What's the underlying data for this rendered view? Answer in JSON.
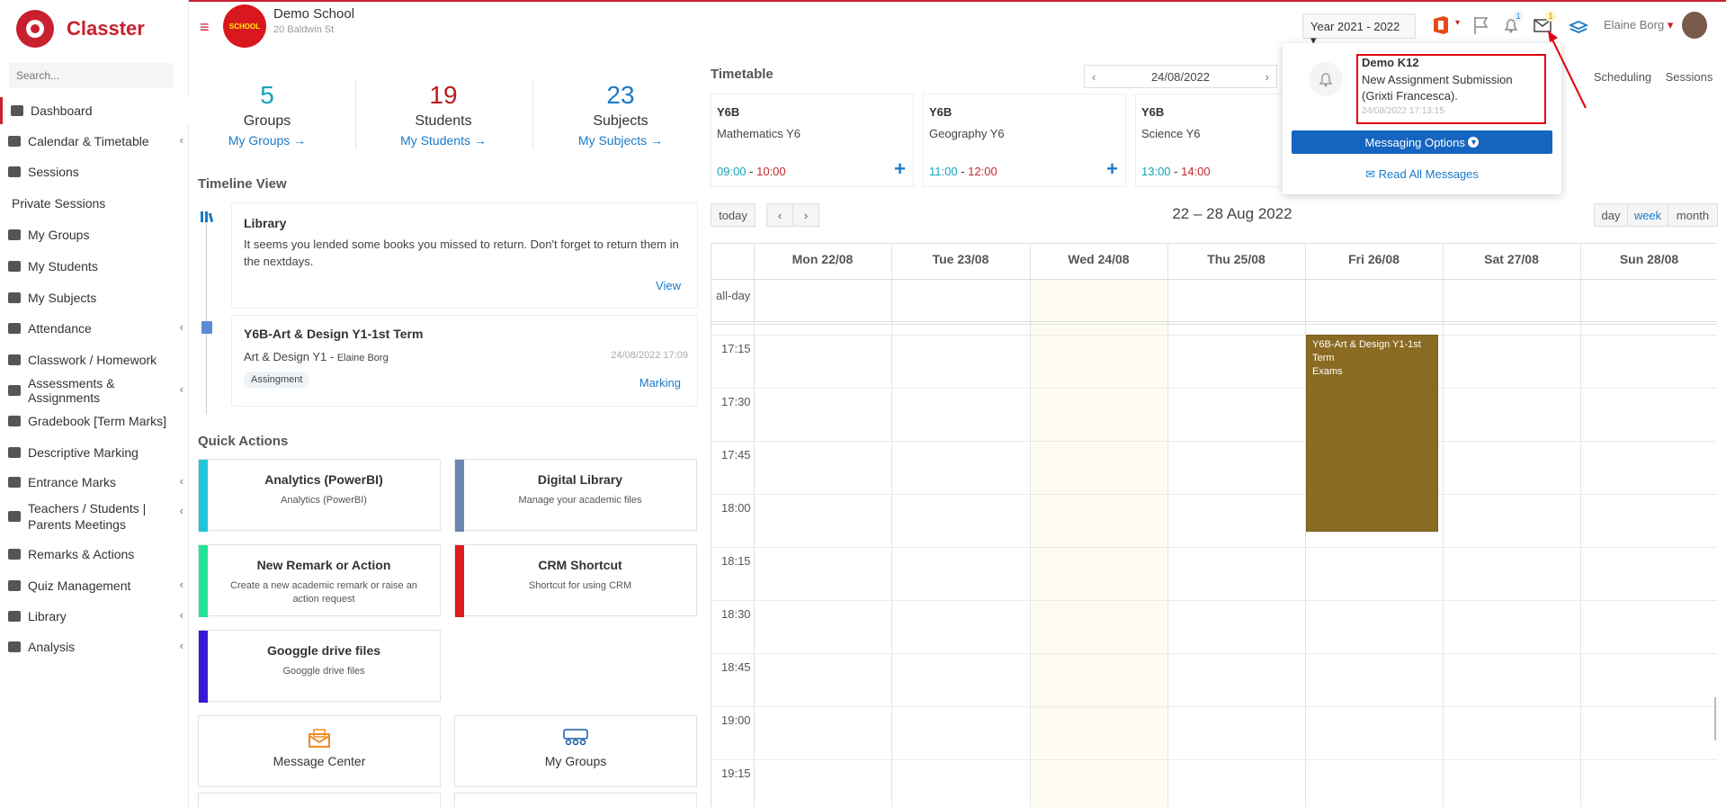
{
  "app": {
    "brand": "Classter",
    "search_placeholder": "Search...",
    "accent": "#c8202e"
  },
  "sidebar": {
    "items": [
      {
        "label": "Dashboard",
        "icon": "laptop-icon",
        "active": true
      },
      {
        "label": "Calendar & Timetable",
        "icon": "calendar-icon",
        "chevron": true
      },
      {
        "label": "Sessions",
        "icon": "sessions-icon"
      },
      {
        "label": "Private Sessions"
      },
      {
        "label": "My Groups",
        "icon": "groups-icon"
      },
      {
        "label": "My Students",
        "icon": "students-icon"
      },
      {
        "label": "My Subjects",
        "icon": "book-icon"
      },
      {
        "label": "Attendance",
        "icon": "attendance-icon",
        "chevron": true
      },
      {
        "label": "Classwork / Homework",
        "icon": "list-icon"
      },
      {
        "label": "Assessments & Assignments",
        "icon": "edit-icon",
        "chevron": true
      },
      {
        "label": "Gradebook [Term Marks]",
        "icon": "gradebook-icon"
      },
      {
        "label": "Descriptive Marking",
        "icon": "marking-icon"
      },
      {
        "label": "Entrance Marks",
        "icon": "clipboard-icon",
        "chevron": true
      },
      {
        "label": "Teachers / Students | Parents Meetings",
        "icon": "meeting-icon",
        "chevron": true
      },
      {
        "label": "Remarks & Actions",
        "icon": "remarks-icon"
      },
      {
        "label": "Quiz Management",
        "icon": "quiz-icon",
        "chevron": true
      },
      {
        "label": "Library",
        "icon": "library-icon",
        "chevron": true
      },
      {
        "label": "Analysis",
        "icon": "analysis-icon",
        "chevron": true
      }
    ]
  },
  "header": {
    "school_name": "Demo School",
    "school_address": "20 Baldwin St",
    "school_logo_text": "SCHOOL",
    "year": "Year 2021 - 2022",
    "user": "Elaine Borg",
    "notif_count": "1",
    "msg_count": "1"
  },
  "stats": [
    {
      "num": "5",
      "label": "Groups",
      "link": "My Groups →",
      "color": "#16a2b8"
    },
    {
      "num": "19",
      "label": "Students",
      "link": "My Students →",
      "color": "#b71c1c"
    },
    {
      "num": "23",
      "label": "Subjects",
      "link": "My Subjects →",
      "color": "#1a7ac8"
    }
  ],
  "timeline": {
    "title": "Timeline View",
    "items": [
      {
        "title": "Library",
        "text": "It seems you lended some books you missed to return. Don't forget to return them in the nextdays.",
        "action": "View"
      },
      {
        "title": "Y6B-Art & Design Y1-1st Term",
        "subject": "Art & Design Y1 - ",
        "teacher": "Elaine Borg",
        "date": "24/08/2022 17:09",
        "tag": "Assingment",
        "action": "Marking"
      }
    ]
  },
  "quick": {
    "title": "Quick Actions",
    "items": [
      {
        "title": "Analytics (PowerBI)",
        "desc": "Analytics (PowerBI)",
        "color": "#22c4dc"
      },
      {
        "title": "Digital Library",
        "desc": "Manage your academic files",
        "color": "#6b86b4"
      },
      {
        "title": "New Remark or Action",
        "desc": "Create a new academic remark or raise an action request",
        "color": "#22e39a"
      },
      {
        "title": "CRM Shortcut",
        "desc": "Shortcut for using CRM",
        "color": "#e11b22"
      },
      {
        "title": "Googgle drive files",
        "desc": "Googgle drive files",
        "color": "#3a17d6"
      }
    ],
    "icon_tiles": [
      {
        "title": "Message Center",
        "icon": "envelope-icon"
      },
      {
        "title": "My Groups",
        "icon": "people-icon"
      }
    ]
  },
  "timetable": {
    "title": "Timetable",
    "date": "24/08/2022",
    "tabs": [
      "Scheduling",
      "Sessions"
    ],
    "cards": [
      {
        "cls": "Y6B",
        "subject": "Mathematics Y6",
        "start": "09:00",
        "end": "10:00"
      },
      {
        "cls": "Y6B",
        "subject": "Geography Y6",
        "start": "11:00",
        "end": "12:00"
      },
      {
        "cls": "Y6B",
        "subject": "Science Y6",
        "start": "13:00",
        "end": "14:00"
      }
    ]
  },
  "calendar": {
    "range": "22 – 28 Aug 2022",
    "today": "today",
    "views": [
      "day",
      "week",
      "month"
    ],
    "active_view": "week",
    "days": [
      "Mon 22/08",
      "Tue 23/08",
      "Wed 24/08",
      "Thu 25/08",
      "Fri 26/08",
      "Sat 27/08",
      "Sun 28/08"
    ],
    "allday": "all-day",
    "times": [
      "17:15",
      "17:30",
      "17:45",
      "18:00",
      "18:15",
      "18:30",
      "18:45",
      "19:00",
      "19:15"
    ],
    "event": {
      "lines": [
        "Y6B-Art & Design Y1-1st",
        "Term",
        "Exams"
      ],
      "color": "#8b6b23"
    }
  },
  "popup": {
    "sender": "Demo K12",
    "message": "New Assignment Submission (Grixti Francesca).",
    "time": "24/08/2022 17:13:15",
    "options": "Messaging Options",
    "read_all": "Read All Messages"
  }
}
